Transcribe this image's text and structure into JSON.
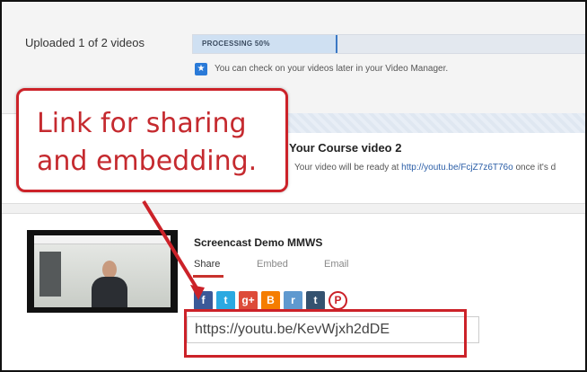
{
  "upload": {
    "status_label": "Uploaded 1 of 2 videos",
    "progress_text": "PROCESSING 50%",
    "progress_fraction": 0.5,
    "info_text": "You can check on your videos later in your Video Manager."
  },
  "video2": {
    "title": "Your Course video 2",
    "ready_prefix": "!",
    "ready_text": "Your video will be ready at",
    "ready_link": "http://youtu.be/FcjZ7z6T76o",
    "ready_suffix": "once it's d"
  },
  "video": {
    "title": "Screencast Demo MMWS",
    "tabs": [
      {
        "label": "Share",
        "active": true
      },
      {
        "label": "Embed",
        "active": false
      },
      {
        "label": "Email",
        "active": false
      }
    ],
    "share_url": "https://youtu.be/KevWjxh2dDE"
  },
  "social_icons": [
    {
      "name": "facebook-icon",
      "glyph": "f",
      "color": "#3b5998"
    },
    {
      "name": "twitter-icon",
      "glyph": "t",
      "color": "#2ba9e1"
    },
    {
      "name": "google-plus-icon",
      "glyph": "g+",
      "color": "#dd4b39"
    },
    {
      "name": "blogger-icon",
      "glyph": "B",
      "color": "#f57d00"
    },
    {
      "name": "reddit-icon",
      "glyph": "r",
      "color": "#5f99cf"
    },
    {
      "name": "tumblr-icon",
      "glyph": "t",
      "color": "#34526f"
    },
    {
      "name": "pinterest-icon",
      "glyph": "P",
      "color": "#cb2027"
    }
  ],
  "callout": {
    "line1": "Link for sharing",
    "line2": "and embedding.",
    "color": "#cc2229"
  }
}
